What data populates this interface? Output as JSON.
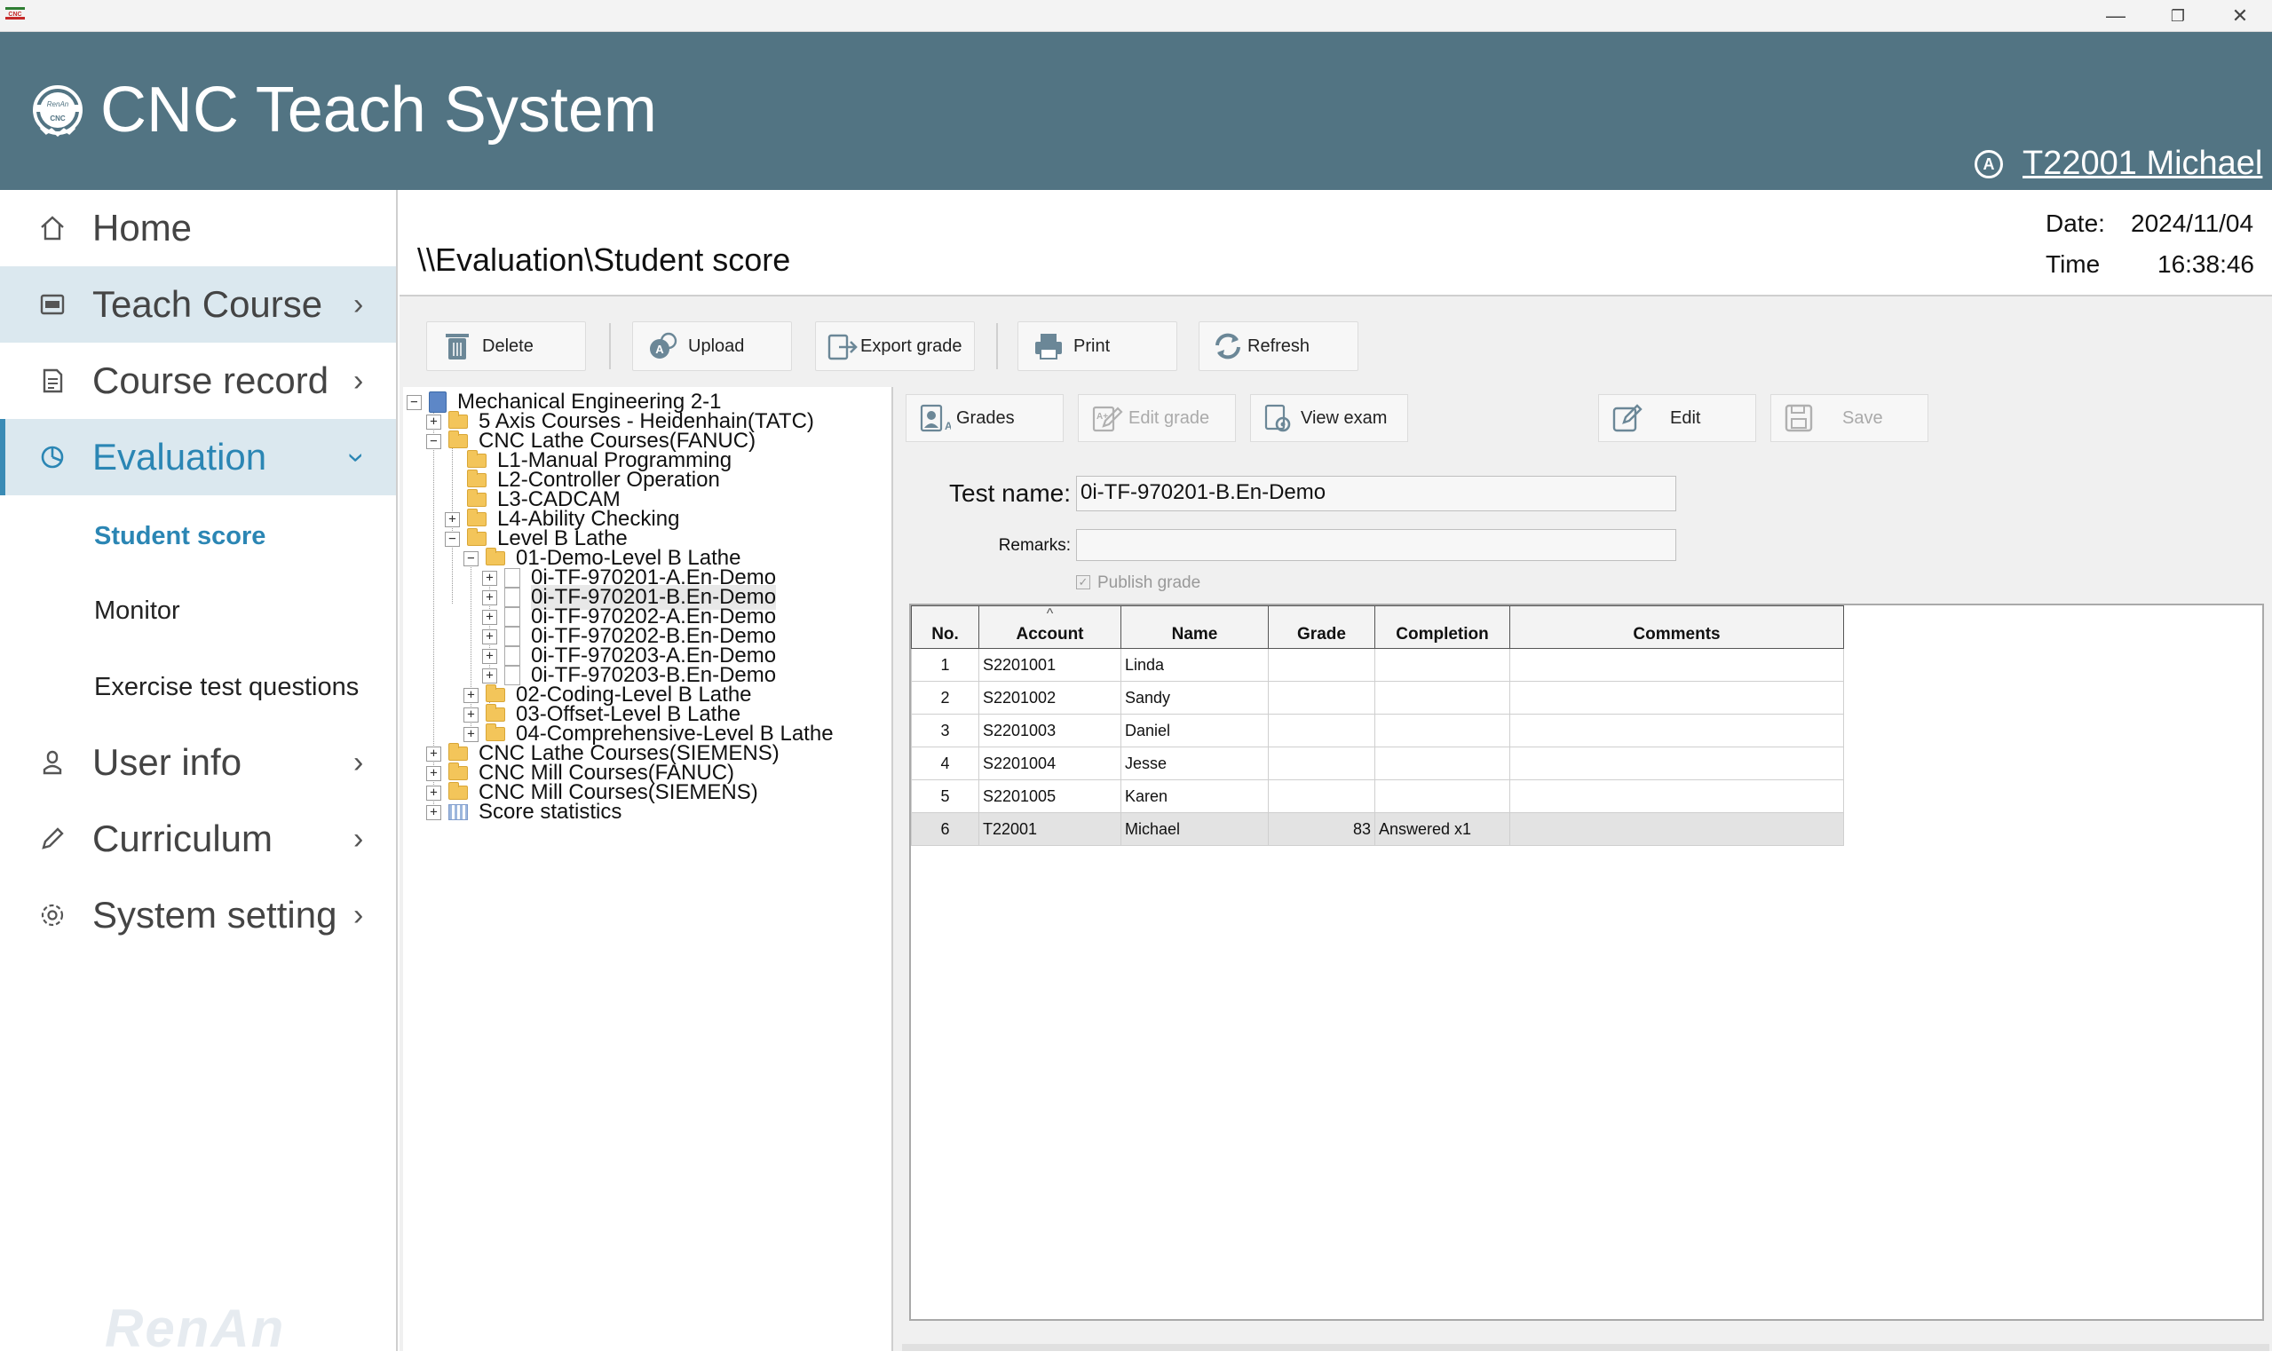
{
  "window": {
    "app_icon_text": "CNC",
    "controls": [
      "—",
      "❐",
      "✕"
    ]
  },
  "header": {
    "title": "CNC Teach System",
    "logo_text": "RenAn",
    "logo_sub": "CNC",
    "user_icon": "A",
    "user": "T22001 Michael",
    "bg_color": "#527483"
  },
  "sidebar": {
    "items": [
      {
        "label": "Home",
        "icon": "home-icon"
      },
      {
        "label": "Teach Course",
        "icon": "cnc-card-icon"
      },
      {
        "label": "Course record",
        "icon": "document-icon"
      },
      {
        "label": "Evaluation",
        "icon": "pie-chart-icon"
      },
      {
        "label": "User info",
        "icon": "user-icon"
      },
      {
        "label": "Curriculum",
        "icon": "pencil-icon"
      },
      {
        "label": "System setting",
        "icon": "gear-icon"
      }
    ],
    "sub_items": [
      "Student score",
      "Monitor",
      "Exercise test questions"
    ],
    "watermark": "RenAn",
    "accent_color": "#2b86b4"
  },
  "page": {
    "path": "\\\\Evaluation\\Student score",
    "date_label": "Date:",
    "date_value": "2024/11/04",
    "time_label": "Time",
    "time_value": "16:38:46"
  },
  "toolbar": {
    "delete": "Delete",
    "upload": "Upload",
    "export": "Export grade",
    "print": "Print",
    "refresh": "Refresh"
  },
  "tree": {
    "root": "Mechanical Engineering 2-1",
    "n1": "5 Axis Courses - Heidenhain(TATC)",
    "n2": "CNC Lathe Courses(FANUC)",
    "n2a": "L1-Manual Programming",
    "n2b": "L2-Controller Operation",
    "n2c": "L3-CADCAM",
    "n2d": "L4-Ability Checking",
    "n2e": "Level B Lathe",
    "n2e1": "01-Demo-Level B Lathe",
    "t1": "0i-TF-970201-A.En-Demo",
    "t2": "0i-TF-970201-B.En-Demo",
    "t3": "0i-TF-970202-A.En-Demo",
    "t4": "0i-TF-970202-B.En-Demo",
    "t5": "0i-TF-970203-A.En-Demo",
    "t6": "0i-TF-970203-B.En-Demo",
    "n2e2": "02-Coding-Level B Lathe",
    "n2e3": "03-Offset-Level B Lathe",
    "n2e4": "04-Comprehensive-Level B Lathe",
    "n3": "CNC Lathe Courses(SIEMENS)",
    "n4": "CNC Mill Courses(FANUC)",
    "n5": "CNC Mill Courses(SIEMENS)",
    "n6": "Score statistics"
  },
  "detail_toolbar": {
    "grades": "Grades",
    "edit_grade": "Edit grade",
    "view_exam": "View exam",
    "edit": "Edit",
    "save": "Save"
  },
  "form": {
    "test_name_label": "Test name:",
    "test_name_value": "0i-TF-970201-B.En-Demo",
    "remarks_label": "Remarks:",
    "remarks_value": "",
    "publish_label": "Publish grade",
    "publish_checked": true
  },
  "grid": {
    "sort_indicator": "^",
    "columns": [
      "No.",
      "Account",
      "Name",
      "Grade",
      "Completion",
      "Comments"
    ],
    "rows": [
      {
        "no": "1",
        "account": "S2201001",
        "name": "Linda",
        "grade": "",
        "completion": "",
        "comments": ""
      },
      {
        "no": "2",
        "account": "S2201002",
        "name": "Sandy",
        "grade": "",
        "completion": "",
        "comments": ""
      },
      {
        "no": "3",
        "account": "S2201003",
        "name": "Daniel",
        "grade": "",
        "completion": "",
        "comments": ""
      },
      {
        "no": "4",
        "account": "S2201004",
        "name": "Jesse",
        "grade": "",
        "completion": "",
        "comments": ""
      },
      {
        "no": "5",
        "account": "S2201005",
        "name": "Karen",
        "grade": "",
        "completion": "",
        "comments": ""
      },
      {
        "no": "6",
        "account": "T22001",
        "name": "Michael",
        "grade": "83",
        "completion": "Answered x1",
        "comments": ""
      }
    ]
  }
}
